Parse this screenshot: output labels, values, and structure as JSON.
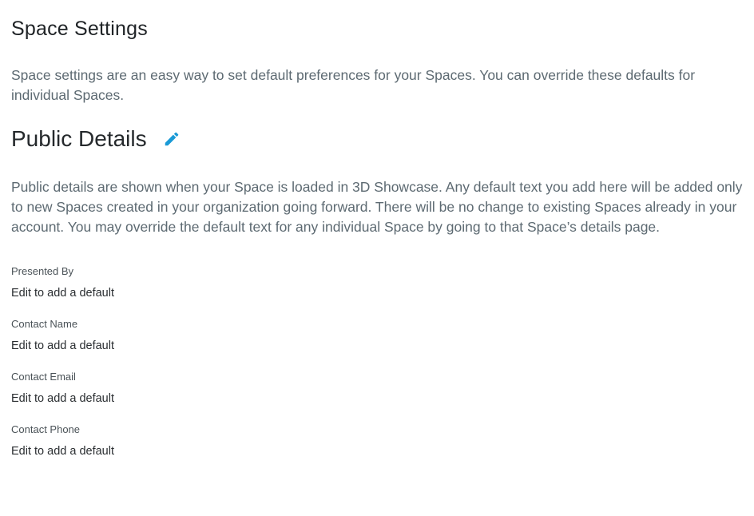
{
  "page": {
    "title": "Space Settings",
    "description": "Space settings are an easy way to set default preferences for your Spaces. You can override these defaults for individual Spaces."
  },
  "public_details": {
    "title": "Public Details",
    "edit_icon": "pencil-icon",
    "accent_color": "#1a9ad6",
    "description": "Public details are shown when your Space is loaded in 3D Showcase. Any default text you add here will be added only to new Spaces created in your organization going forward. There will be no change to existing Spaces already in your account. You may override the default text for any individual Space by going to that Space’s details page.",
    "fields": [
      {
        "label": "Presented By",
        "value": "Edit to add a default"
      },
      {
        "label": "Contact Name",
        "value": "Edit to add a default"
      },
      {
        "label": "Contact Email",
        "value": "Edit to add a default"
      },
      {
        "label": "Contact Phone",
        "value": "Edit to add a default"
      }
    ]
  }
}
